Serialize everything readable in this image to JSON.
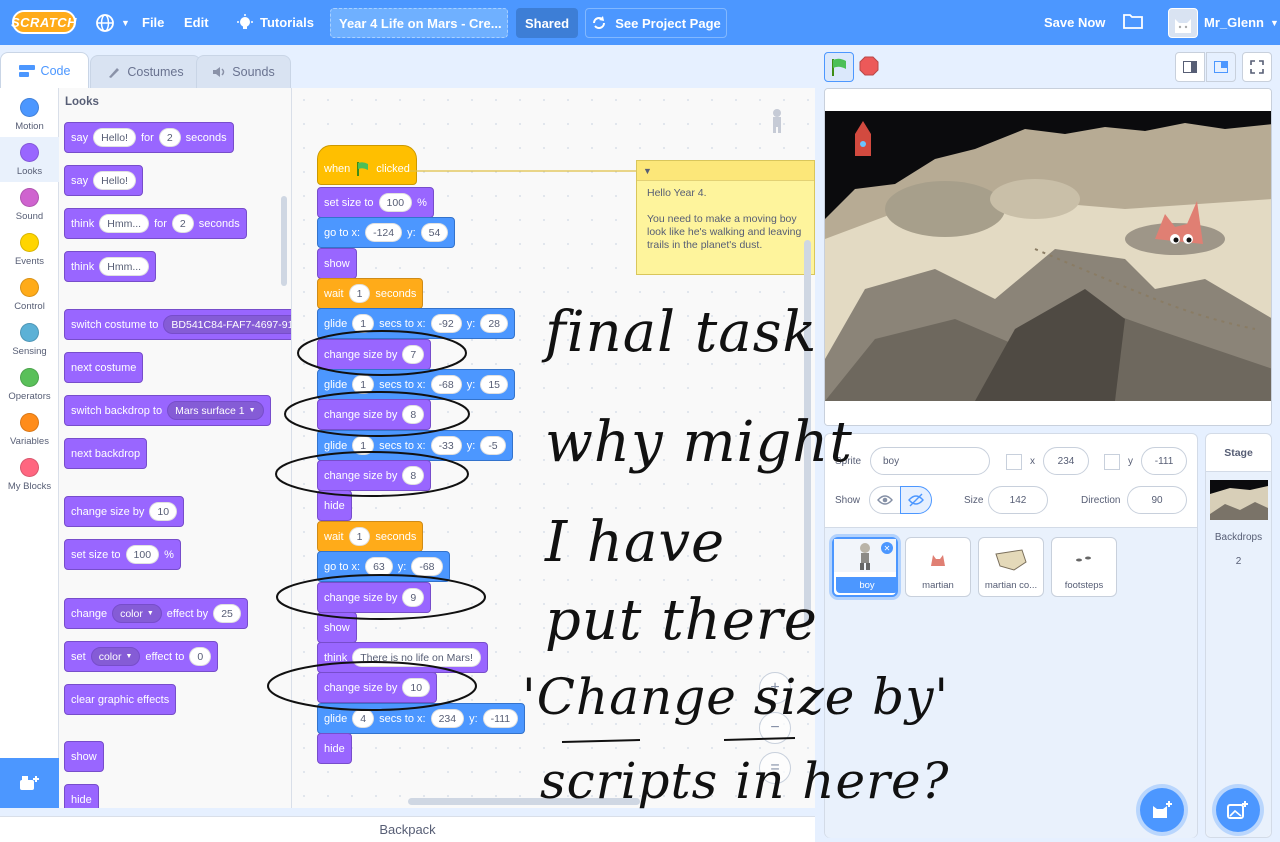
{
  "menubar": {
    "logo": "SCRATCH",
    "file": "File",
    "edit": "Edit",
    "tutorials": "Tutorials",
    "project_title": "Year 4 Life on Mars - Cre...",
    "shared": "Shared",
    "see_project_page": "See Project Page",
    "save_now": "Save Now",
    "username": "Mr_Glenn"
  },
  "tabs": {
    "code": "Code",
    "costumes": "Costumes",
    "sounds": "Sounds"
  },
  "categories": [
    {
      "label": "Motion",
      "color": "#4c97ff"
    },
    {
      "label": "Looks",
      "color": "#9966ff"
    },
    {
      "label": "Sound",
      "color": "#cf63cf"
    },
    {
      "label": "Events",
      "color": "#ffd500"
    },
    {
      "label": "Control",
      "color": "#ffab19"
    },
    {
      "label": "Sensing",
      "color": "#5cb1d6"
    },
    {
      "label": "Operators",
      "color": "#59c059"
    },
    {
      "label": "Variables",
      "color": "#ff8c1a"
    },
    {
      "label": "My Blocks",
      "color": "#ff6680"
    }
  ],
  "palette": {
    "header": "Looks",
    "say_for": {
      "a": "say",
      "v1": "Hello!",
      "b": "for",
      "v2": "2",
      "c": "seconds"
    },
    "say": {
      "a": "say",
      "v1": "Hello!"
    },
    "think_for": {
      "a": "think",
      "v1": "Hmm...",
      "b": "for",
      "v2": "2",
      "c": "seconds"
    },
    "think": {
      "a": "think",
      "v1": "Hmm..."
    },
    "switch_costume": {
      "a": "switch costume to",
      "v1": "BD541C84-FAF7-4697-91"
    },
    "next_costume": "next costume",
    "switch_backdrop": {
      "a": "switch backdrop to",
      "v1": "Mars surface 1"
    },
    "next_backdrop": "next backdrop",
    "change_size": {
      "a": "change size by",
      "v1": "10"
    },
    "set_size": {
      "a": "set size to",
      "v1": "100",
      "b": "%"
    },
    "change_effect": {
      "a": "change",
      "v1": "color",
      "b": "effect by",
      "v2": "25"
    },
    "set_effect": {
      "a": "set",
      "v1": "color",
      "b": "effect to",
      "v2": "0"
    },
    "clear_effects": "clear graphic effects",
    "show": "show",
    "hide": "hide"
  },
  "script": {
    "hat": {
      "a": "when",
      "b": "clicked"
    },
    "set_size": {
      "a": "set size to",
      "v1": "100",
      "b": "%"
    },
    "goto1": {
      "a": "go to x:",
      "x": "-124",
      "b": "y:",
      "y": "54"
    },
    "show1": "show",
    "wait1": {
      "a": "wait",
      "v": "1",
      "b": "seconds"
    },
    "glide1": {
      "a": "glide",
      "v": "1",
      "b": "secs to x:",
      "x": "-92",
      "c": "y:",
      "y": "28"
    },
    "change1": {
      "a": "change size by",
      "v": "7"
    },
    "glide2": {
      "a": "glide",
      "v": "1",
      "b": "secs to x:",
      "x": "-68",
      "c": "y:",
      "y": "15"
    },
    "change2": {
      "a": "change size by",
      "v": "8"
    },
    "glide3": {
      "a": "glide",
      "v": "1",
      "b": "secs to x:",
      "x": "-33",
      "c": "y:",
      "y": "-5"
    },
    "change3": {
      "a": "change size by",
      "v": "8"
    },
    "hide1": "hide",
    "wait2": {
      "a": "wait",
      "v": "1",
      "b": "seconds"
    },
    "goto2": {
      "a": "go to x:",
      "x": "63",
      "b": "y:",
      "y": "-68"
    },
    "change4": {
      "a": "change size by",
      "v": "9"
    },
    "show2": "show",
    "think": {
      "a": "think",
      "v": "There is no life on Mars!"
    },
    "change5": {
      "a": "change size by",
      "v": "10"
    },
    "glide4": {
      "a": "glide",
      "v": "4",
      "b": "secs to x:",
      "x": "234",
      "c": "y:",
      "y": "-111"
    },
    "hide2": "hide"
  },
  "comment": {
    "line1": "Hello Year 4.",
    "line2": "You need to make a moving boy look like he's walking and leaving trails in the planet's dust."
  },
  "handwriting": {
    "l1": "final task",
    "l2": "why might",
    "l3": "I have",
    "l4": "put there",
    "l5": "'Change size by'",
    "l6": "scripts in here?"
  },
  "backpack": "Backpack",
  "sprite_info": {
    "sprite_label": "Sprite",
    "sprite_name": "boy",
    "x_label": "x",
    "x": "234",
    "y_label": "y",
    "y": "-111",
    "show_label": "Show",
    "size_label": "Size",
    "size": "142",
    "direction_label": "Direction",
    "direction": "90"
  },
  "sprites": [
    {
      "name": "boy"
    },
    {
      "name": "martian"
    },
    {
      "name": "martian co..."
    },
    {
      "name": "footsteps"
    }
  ],
  "stage_pane": {
    "title": "Stage",
    "backdrops_label": "Backdrops",
    "backdrops_count": "2"
  },
  "colors": {
    "accent": "#4c97ff",
    "looks": "#9966ff",
    "control": "#ffab19",
    "events": "#ffbf00",
    "menu": "#4c97ff"
  }
}
